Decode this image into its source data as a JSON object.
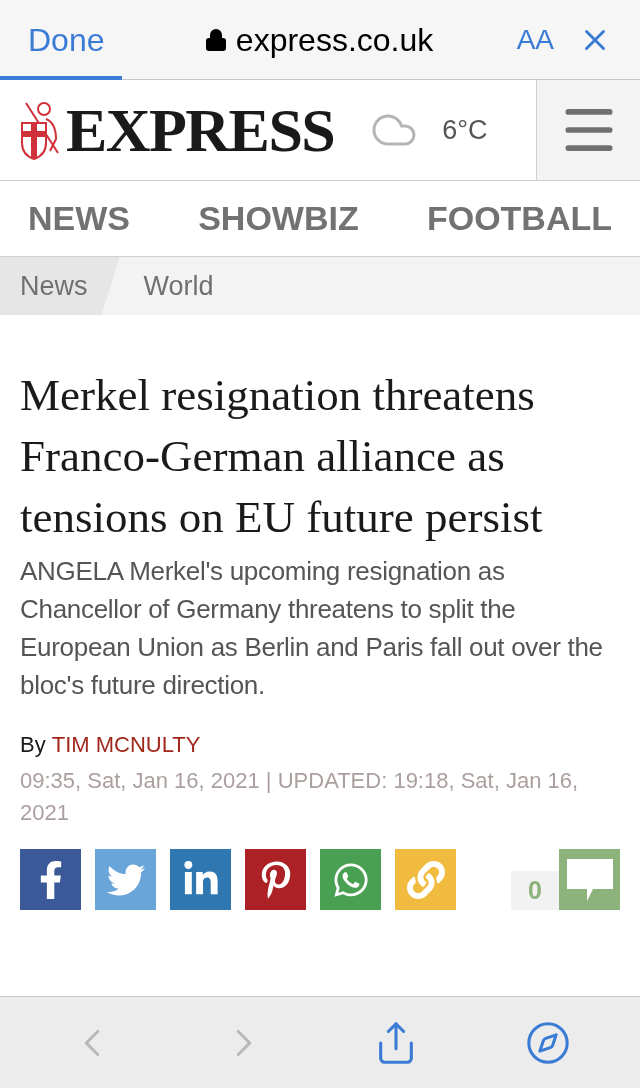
{
  "browser_bar": {
    "done": "Done",
    "url": "express.co.uk",
    "text_size": "AA",
    "progress": {
      "level": 0.19
    }
  },
  "header": {
    "logo": "EXPRESS",
    "temperature": "6°C"
  },
  "nav": [
    {
      "label": "NEWS"
    },
    {
      "label": "SHOWBIZ"
    },
    {
      "label": "FOOTBALL"
    }
  ],
  "breadcrumb": [
    {
      "label": "News",
      "selected": true
    },
    {
      "label": "World",
      "selected": false
    }
  ],
  "article": {
    "headline": "Merkel resignation threatens Franco-German alliance as tensions on EU future persist",
    "summary": "ANGELA Merkel's upcoming resignation as Chancellor of Germany threatens to split the European Union as Berlin and Paris fall out over the bloc's future direction.",
    "by": "By",
    "author": "TIM MCNULTY",
    "date": "09:35, Sat, Jan 16, 2021 | UPDATED: 19:18, Sat, Jan 16, 2021"
  },
  "share": [
    {
      "kind": "facebook",
      "color": "#3b5998"
    },
    {
      "kind": "twitter",
      "color": "#6aa5d9"
    },
    {
      "kind": "linkedin",
      "color": "#2f77b1"
    },
    {
      "kind": "pinterest",
      "color": "#ab2125"
    },
    {
      "kind": "whatsapp",
      "color": "#4aa052"
    },
    {
      "kind": "link",
      "color": "#f1bb3f"
    }
  ],
  "comments": {
    "count": "0"
  },
  "toolbar": [
    {
      "kind": "back",
      "disabled": true
    },
    {
      "kind": "forward",
      "disabled": true
    },
    {
      "kind": "share",
      "disabled": false
    },
    {
      "kind": "compass",
      "disabled": false
    }
  ]
}
